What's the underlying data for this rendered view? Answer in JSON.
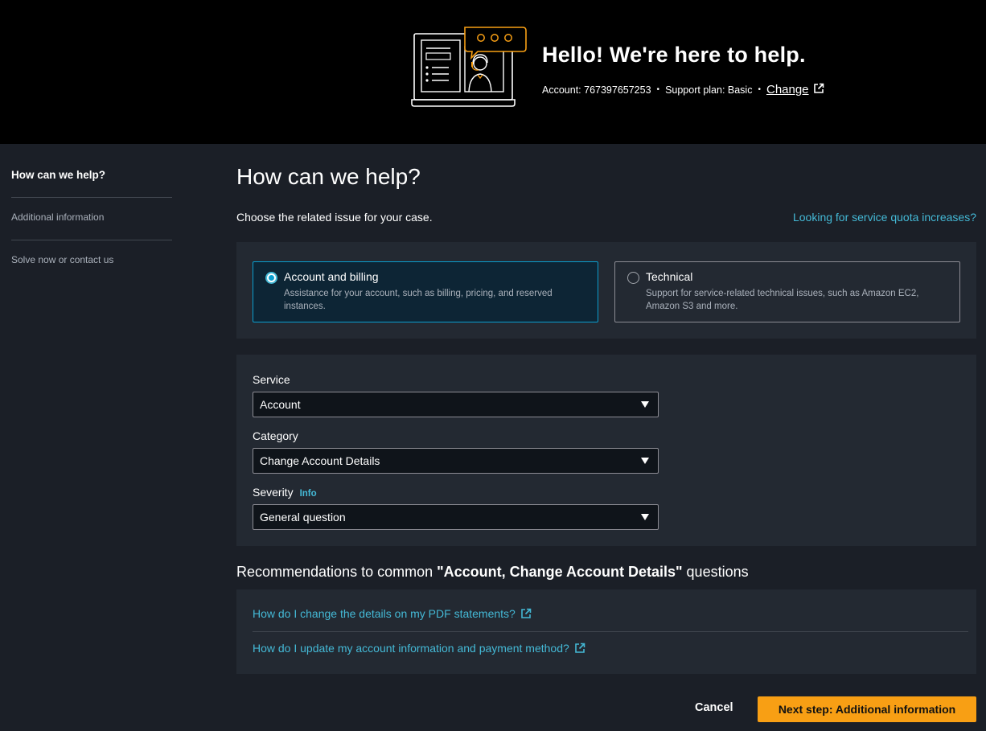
{
  "header": {
    "title": "Hello!  We're here to help.",
    "account_label": "Account: 767397657253",
    "support_plan_label": "Support plan: Basic",
    "separator": "•",
    "change_link": "Change"
  },
  "sidebar": {
    "items": [
      {
        "label": "How can we help?",
        "active": true
      },
      {
        "label": "Additional information",
        "active": false
      },
      {
        "label": "Solve now or contact us",
        "active": false
      }
    ]
  },
  "main": {
    "title": "How can we help?",
    "subtitle": "Choose the related issue for your case.",
    "quota_link": "Looking for service quota increases?",
    "issue_types": [
      {
        "title": "Account and billing",
        "description": "Assistance for your account, such as billing, pricing, and reserved instances.",
        "selected": true
      },
      {
        "title": "Technical",
        "description": "Support for service-related technical issues, such as Amazon EC2, Amazon S3 and more.",
        "selected": false
      }
    ],
    "form": {
      "service_label": "Service",
      "service_value": "Account",
      "category_label": "Category",
      "category_value": "Change Account Details",
      "severity_label": "Severity",
      "severity_info": "Info",
      "severity_value": "General question"
    },
    "recommendations": {
      "title_prefix": "Recommendations to common ",
      "title_topic": "\"Account, Change Account Details\"",
      "title_suffix": " questions",
      "links": [
        "How do I change the details on my PDF statements?",
        "How do I update my account information and payment method?"
      ]
    }
  },
  "footer": {
    "cancel_label": "Cancel",
    "next_label": "Next step: Additional information"
  },
  "colors": {
    "accent": "#f89f14",
    "link": "#44b9d6",
    "selected_border": "#0a9ecf",
    "background": "#1b1f27",
    "panel": "#232932"
  }
}
